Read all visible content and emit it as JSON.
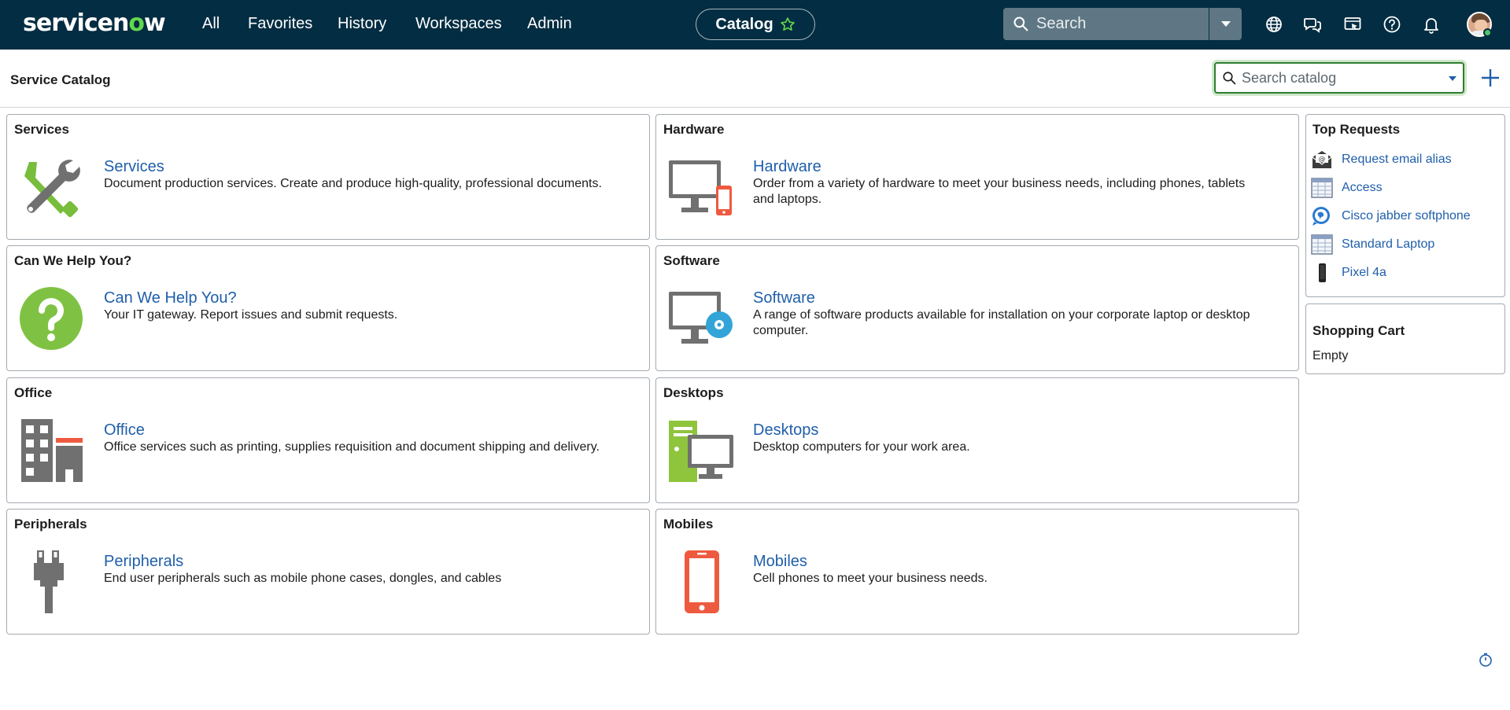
{
  "brand": {
    "logo_text_a": "servicen",
    "logo_text_o": "o",
    "logo_text_b": "w"
  },
  "nav": {
    "links": [
      "All",
      "Favorites",
      "History",
      "Workspaces",
      "Admin"
    ],
    "context_pill": "Catalog",
    "search_label": "Search"
  },
  "subheader": {
    "title": "Service Catalog",
    "search_placeholder": "Search catalog"
  },
  "categories": [
    {
      "header": "Services",
      "title": "Services",
      "description": "Document production services. Create and produce high-quality, professional documents.",
      "icon": "wrench-screwdriver-icon"
    },
    {
      "header": "Hardware",
      "title": "Hardware",
      "description": "Order from a variety of hardware to meet your business needs, including phones, tablets and laptops.",
      "icon": "monitor-phone-icon"
    },
    {
      "header": "Can We Help You?",
      "title": "Can We Help You?",
      "description": "Your IT gateway. Report issues and submit requests.",
      "icon": "question-icon"
    },
    {
      "header": "Software",
      "title": "Software",
      "description": "A range of software products available for installation on your corporate laptop or desktop computer.",
      "icon": "monitor-disc-icon"
    },
    {
      "header": "Office",
      "title": "Office",
      "description": "Office services such as printing, supplies requisition and document shipping and delivery.",
      "icon": "office-building-icon"
    },
    {
      "header": "Desktops",
      "title": "Desktops",
      "description": "Desktop computers for your work area.",
      "icon": "desktop-tower-icon"
    },
    {
      "header": "Peripherals",
      "title": "Peripherals",
      "description": "End user peripherals such as mobile phone cases, dongles, and cables",
      "icon": "plug-icon"
    },
    {
      "header": "Mobiles",
      "title": "Mobiles",
      "description": "Cell phones to meet your business needs.",
      "icon": "mobile-phone-icon"
    }
  ],
  "top_requests": {
    "header": "Top Requests",
    "items": [
      {
        "label": "Request email alias",
        "icon": "email-envelope-icon"
      },
      {
        "label": "Access",
        "icon": "table-grid-icon"
      },
      {
        "label": "Cisco jabber softphone",
        "icon": "jabber-icon"
      },
      {
        "label": "Standard Laptop",
        "icon": "table-grid-icon"
      },
      {
        "label": "Pixel 4a",
        "icon": "phone-icon"
      }
    ]
  },
  "shopping_cart": {
    "header": "Shopping Cart",
    "status": "Empty"
  },
  "colors": {
    "nav_bg": "#032d42",
    "link": "#1f5faa",
    "accent_green": "#62d84e",
    "search_focus": "#2e7d32"
  }
}
